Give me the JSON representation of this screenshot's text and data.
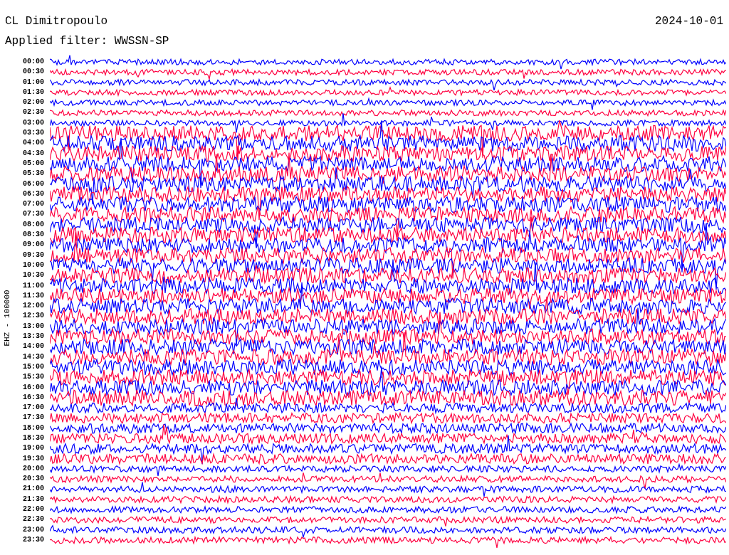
{
  "header": {
    "station": "CL Dimitropoulo",
    "filter": "Applied filter: WWSSN-SP",
    "date": "2024-10-01"
  },
  "channel_label": "EHZ - 100000",
  "rows": [
    {
      "time": "00:00",
      "color": "#0000ff"
    },
    {
      "time": "00:30",
      "color": "#ff0040"
    },
    {
      "time": "01:00",
      "color": "#0000ff"
    },
    {
      "time": "01:30",
      "color": "#ff0040"
    },
    {
      "time": "02:00",
      "color": "#0000ff"
    },
    {
      "time": "02:30",
      "color": "#ff0040"
    },
    {
      "time": "03:00",
      "color": "#0000ff"
    },
    {
      "time": "03:30",
      "color": "#ff0040"
    },
    {
      "time": "04:00",
      "color": "#0000ff"
    },
    {
      "time": "04:30",
      "color": "#ff0040"
    },
    {
      "time": "05:00",
      "color": "#0000ff"
    },
    {
      "time": "05:30",
      "color": "#ff0040"
    },
    {
      "time": "06:00",
      "color": "#0000ff"
    },
    {
      "time": "06:30",
      "color": "#ff0040"
    },
    {
      "time": "07:00",
      "color": "#0000ff"
    },
    {
      "time": "07:30",
      "color": "#ff0040"
    },
    {
      "time": "08:00",
      "color": "#0000ff"
    },
    {
      "time": "08:30",
      "color": "#ff0040"
    },
    {
      "time": "09:00",
      "color": "#0000ff"
    },
    {
      "time": "09:30",
      "color": "#ff0040"
    },
    {
      "time": "10:00",
      "color": "#0000ff"
    },
    {
      "time": "10:30",
      "color": "#ff0040"
    },
    {
      "time": "11:00",
      "color": "#0000ff"
    },
    {
      "time": "11:30",
      "color": "#ff0040"
    },
    {
      "time": "12:00",
      "color": "#0000ff"
    },
    {
      "time": "12:30",
      "color": "#ff0040"
    },
    {
      "time": "13:00",
      "color": "#0000ff"
    },
    {
      "time": "13:30",
      "color": "#ff0040"
    },
    {
      "time": "14:00",
      "color": "#0000ff"
    },
    {
      "time": "14:30",
      "color": "#ff0040"
    },
    {
      "time": "15:00",
      "color": "#0000ff"
    },
    {
      "time": "15:30",
      "color": "#ff0040"
    },
    {
      "time": "16:00",
      "color": "#0000ff"
    },
    {
      "time": "16:30",
      "color": "#ff0040"
    },
    {
      "time": "17:00",
      "color": "#0000ff"
    },
    {
      "time": "17:30",
      "color": "#ff0040"
    },
    {
      "time": "18:00",
      "color": "#0000ff"
    },
    {
      "time": "18:30",
      "color": "#ff0040"
    },
    {
      "time": "19:00",
      "color": "#0000ff"
    },
    {
      "time": "19:30",
      "color": "#ff0040"
    },
    {
      "time": "20:00",
      "color": "#0000ff"
    },
    {
      "time": "20:30",
      "color": "#ff0040"
    },
    {
      "time": "21:00",
      "color": "#0000ff"
    },
    {
      "time": "21:30",
      "color": "#ff0040"
    },
    {
      "time": "22:00",
      "color": "#0000ff"
    },
    {
      "time": "22:30",
      "color": "#ff0040"
    },
    {
      "time": "23:00",
      "color": "#0000ff"
    },
    {
      "time": "23:30",
      "color": "#ff0040"
    }
  ]
}
